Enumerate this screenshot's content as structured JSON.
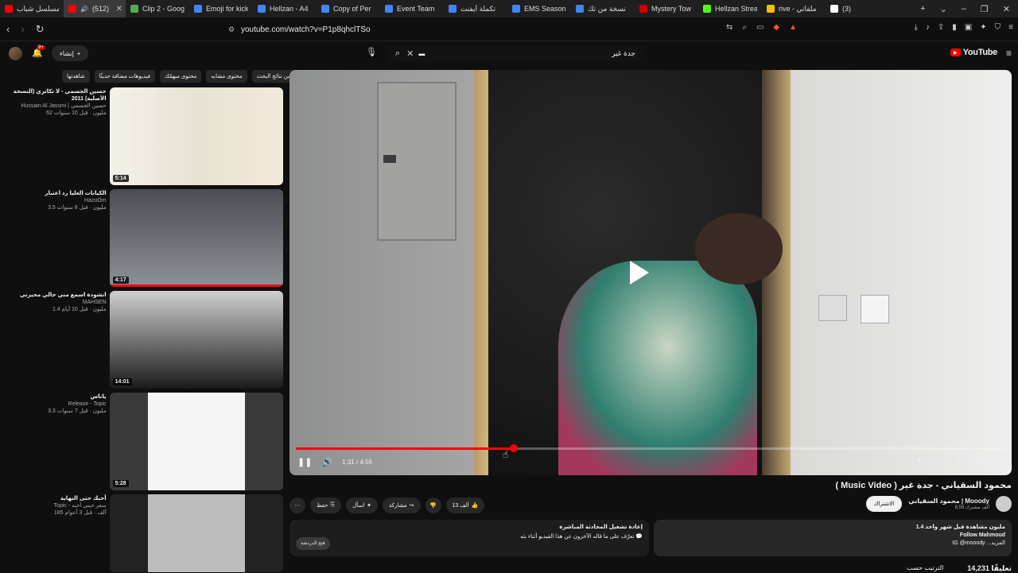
{
  "tabs": [
    {
      "title": "مسلسل شباب",
      "color": "#ff0000"
    },
    {
      "title": "(512)",
      "color": "#ff0000",
      "active": true
    },
    {
      "title": "Clip 2 - Goog",
      "color": "#4caf50"
    },
    {
      "title": "Emoji for kick",
      "color": "#4285f4"
    },
    {
      "title": "Hellzan - A4",
      "color": "#4285f4"
    },
    {
      "title": "Copy of Per",
      "color": "#4285f4"
    },
    {
      "title": "Event Team",
      "color": "#4285f4"
    },
    {
      "title": "تكملة أيفنت",
      "color": "#4285f4"
    },
    {
      "title": "EMS Season",
      "color": "#4285f4"
    },
    {
      "title": "نسخة من تك",
      "color": "#4285f4"
    },
    {
      "title": "Mystery Tow",
      "color": "#cc0000"
    },
    {
      "title": "Hellzan Strea",
      "color": "#53fc18"
    },
    {
      "title": "rive - ملفاتي",
      "color": "#fbbc04"
    },
    {
      "title": "(3)",
      "color": "#ffffff"
    }
  ],
  "address": {
    "url": "youtube.com/watch?v=P1p8qhclTSo"
  },
  "header": {
    "logo": "YouTube",
    "search_value": "جدة غير",
    "create_label": "إنشاء",
    "notif_count": "9+"
  },
  "chips": [
    "الكل",
    "من نتائج البحث",
    "محتوى مشابه",
    "محتوى ميهمّك",
    "فيديوهات مضافة حديثًا",
    "شاهدتها"
  ],
  "recs": [
    {
      "title": "حسين الجسمي - لا تكاثري (النسخة الأصلية) 2011",
      "channel": "Hussain Al Jassmi | حسين الجسمي",
      "stats": "62 مليون · قبل 10 سنوات",
      "duration": "5:14"
    },
    {
      "title": "الكيانات العليا رد اعتبار",
      "channel": "HazoOm",
      "stats": "3.5 مليون · قبل 8 سنوات",
      "duration": "4:17"
    },
    {
      "title": "انشودة اسمع مني حالي محيرني",
      "channel": "MAHSEN",
      "stats": "1.4 مليون · قبل 10 أيام",
      "duration": "14:01"
    },
    {
      "title": "ياناس",
      "channel": "Release - Topic",
      "stats": "3.3 مليون · قبل 7 سنوات",
      "duration": "5:28"
    },
    {
      "title": "أحبك حتى النهاية",
      "channel": "Topic - سعر حبني أحبه",
      "stats": "185 ألف · قبل 3 أعوام",
      "duration": ""
    }
  ],
  "player": {
    "time": "1:31 / 4:56",
    "progress": 0.307
  },
  "video": {
    "title": "محمود السقياني - جدة غير ( Music Video )",
    "channel": "محمود السقياني | Mooody",
    "subs": "8.59 ألف مشترك",
    "subscribe": "الاشتراك",
    "likes": "13 ألف",
    "share": "مشاركة",
    "ask": "اسأل",
    "save": "حفظ"
  },
  "description": {
    "stats": "1.4 مليون مشاهدة  قبل شهر واحد",
    "line1": "Follow Mahmoud",
    "line2": "IG @mooody ...المزيد"
  },
  "live": {
    "title": "إعادة تشغيل المحادثة المباشرة",
    "text": "تعرّف على ما قاله الآخرون عن هذا الفيديو أثناء بثه",
    "open": "فتح الدردشة"
  },
  "comments": {
    "count": "14,231 تعليقًا",
    "sort": "الترتيب حسب"
  }
}
